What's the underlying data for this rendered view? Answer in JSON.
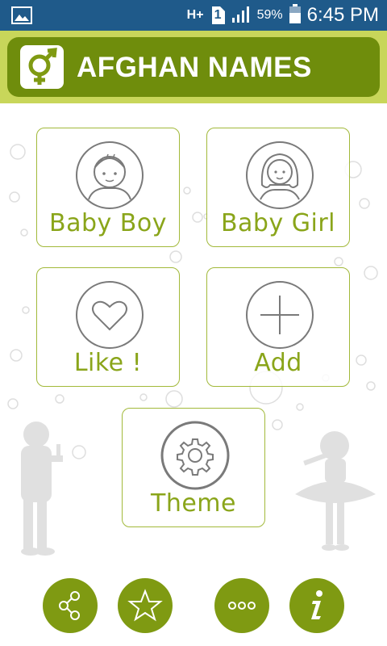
{
  "status_bar": {
    "network": "H+",
    "sim": "1",
    "battery_percent": "59%",
    "time": "6:45 PM"
  },
  "app_bar": {
    "title": "AFGHAN NAMES",
    "logo_icon": "gender-symbol-icon",
    "color": "#6f8d0c"
  },
  "tiles": [
    {
      "label": "Baby Boy",
      "icon": "baby-boy-icon"
    },
    {
      "label": "Baby Girl",
      "icon": "baby-girl-icon"
    },
    {
      "label": "Like !",
      "icon": "heart-icon"
    },
    {
      "label": "Add",
      "icon": "plus-icon"
    },
    {
      "label": "Theme",
      "icon": "gear-icon"
    }
  ],
  "bottom_buttons": [
    {
      "icon": "share-icon"
    },
    {
      "icon": "star-icon"
    },
    {
      "icon": "more-icon"
    },
    {
      "icon": "info-icon"
    }
  ],
  "colors": {
    "accent": "#8aa51a",
    "button": "#7f9a12",
    "status_bar": "#1f5a8a"
  }
}
